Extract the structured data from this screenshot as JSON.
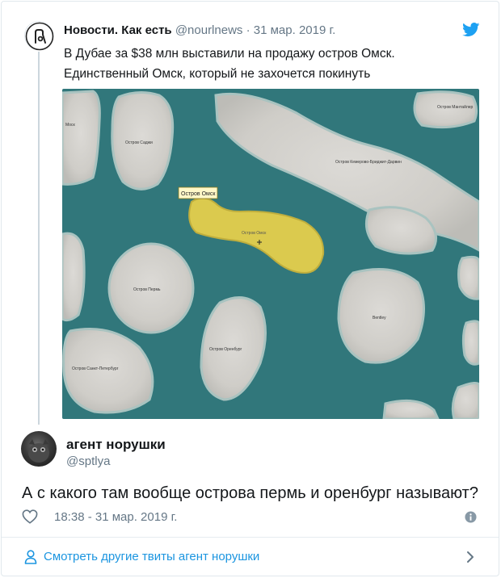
{
  "parent_tweet": {
    "author_name": "Новости. Как есть",
    "author_handle": "@nourlnews",
    "separator": "·",
    "date": "31 мар. 2019 г.",
    "text_line1": "В Дубае за $38 млн выставили на продажу остров Омск.",
    "text_line2": "Единственный Омск, который не захочется покинуть",
    "media": {
      "tooltip": "Остров Омск",
      "labels": {
        "omsk": "Остров Омск",
        "sadzhi": "Остров Саджи",
        "mosk": "Моск",
        "kemerovo": "Остров Кемерово-Бриджит-Дарвин",
        "mantiler": "Остров Мантайлер",
        "perm": "Остров Пермь",
        "orenburg": "Остров Оренбург",
        "spb": "Остров Санкт-Петербург",
        "right": "Bentley"
      },
      "colors": {
        "water": "#2e7377",
        "island": "#d4d2cd",
        "highlight": "#e5cf4c"
      }
    }
  },
  "reply": {
    "author_name": "агент норушки",
    "author_handle": "@sptlya",
    "text": "А с какого там вообще острова пермь и оренбург называют?",
    "timestamp": "18:38 - 31 мар. 2019 г."
  },
  "footer": {
    "more_tweets_label": "Смотреть другие твиты агент норушки"
  },
  "icons": {
    "parent_avatar": "logo-icon",
    "twitter": "twitter-bird-icon",
    "like": "heart-icon",
    "info": "info-icon",
    "person": "person-icon",
    "chevron": "chevron-right-icon"
  },
  "colors": {
    "link": "#1b95e0",
    "secondary_text": "#657786",
    "border": "#e1e8ed"
  }
}
